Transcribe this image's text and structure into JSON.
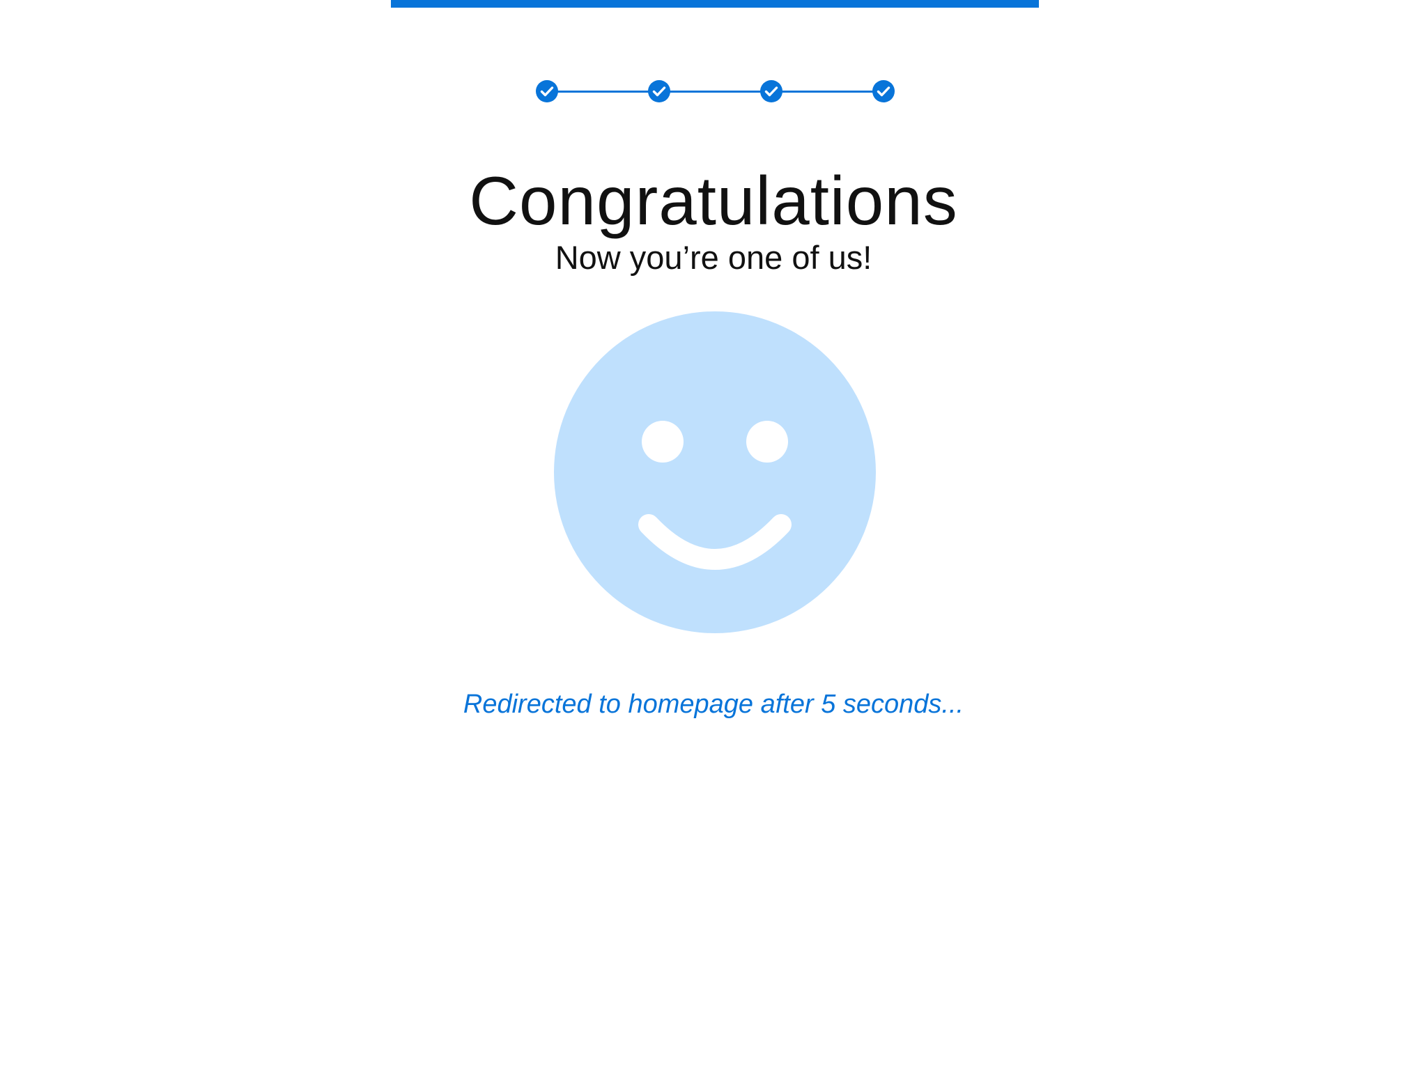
{
  "colors": {
    "accent": "#0874d9",
    "smiley_fill": "#bfe0fd",
    "text": "#111111",
    "background": "#ffffff"
  },
  "progress": {
    "steps_total": 4,
    "steps_completed": 4,
    "step_icon": "check-circle-icon"
  },
  "hero": {
    "title": "Congratulations",
    "subtitle": "Now you’re one of us!",
    "illustration_icon": "smiley-face-icon"
  },
  "redirect": {
    "message": "Redirected to homepage after 5 seconds..."
  }
}
